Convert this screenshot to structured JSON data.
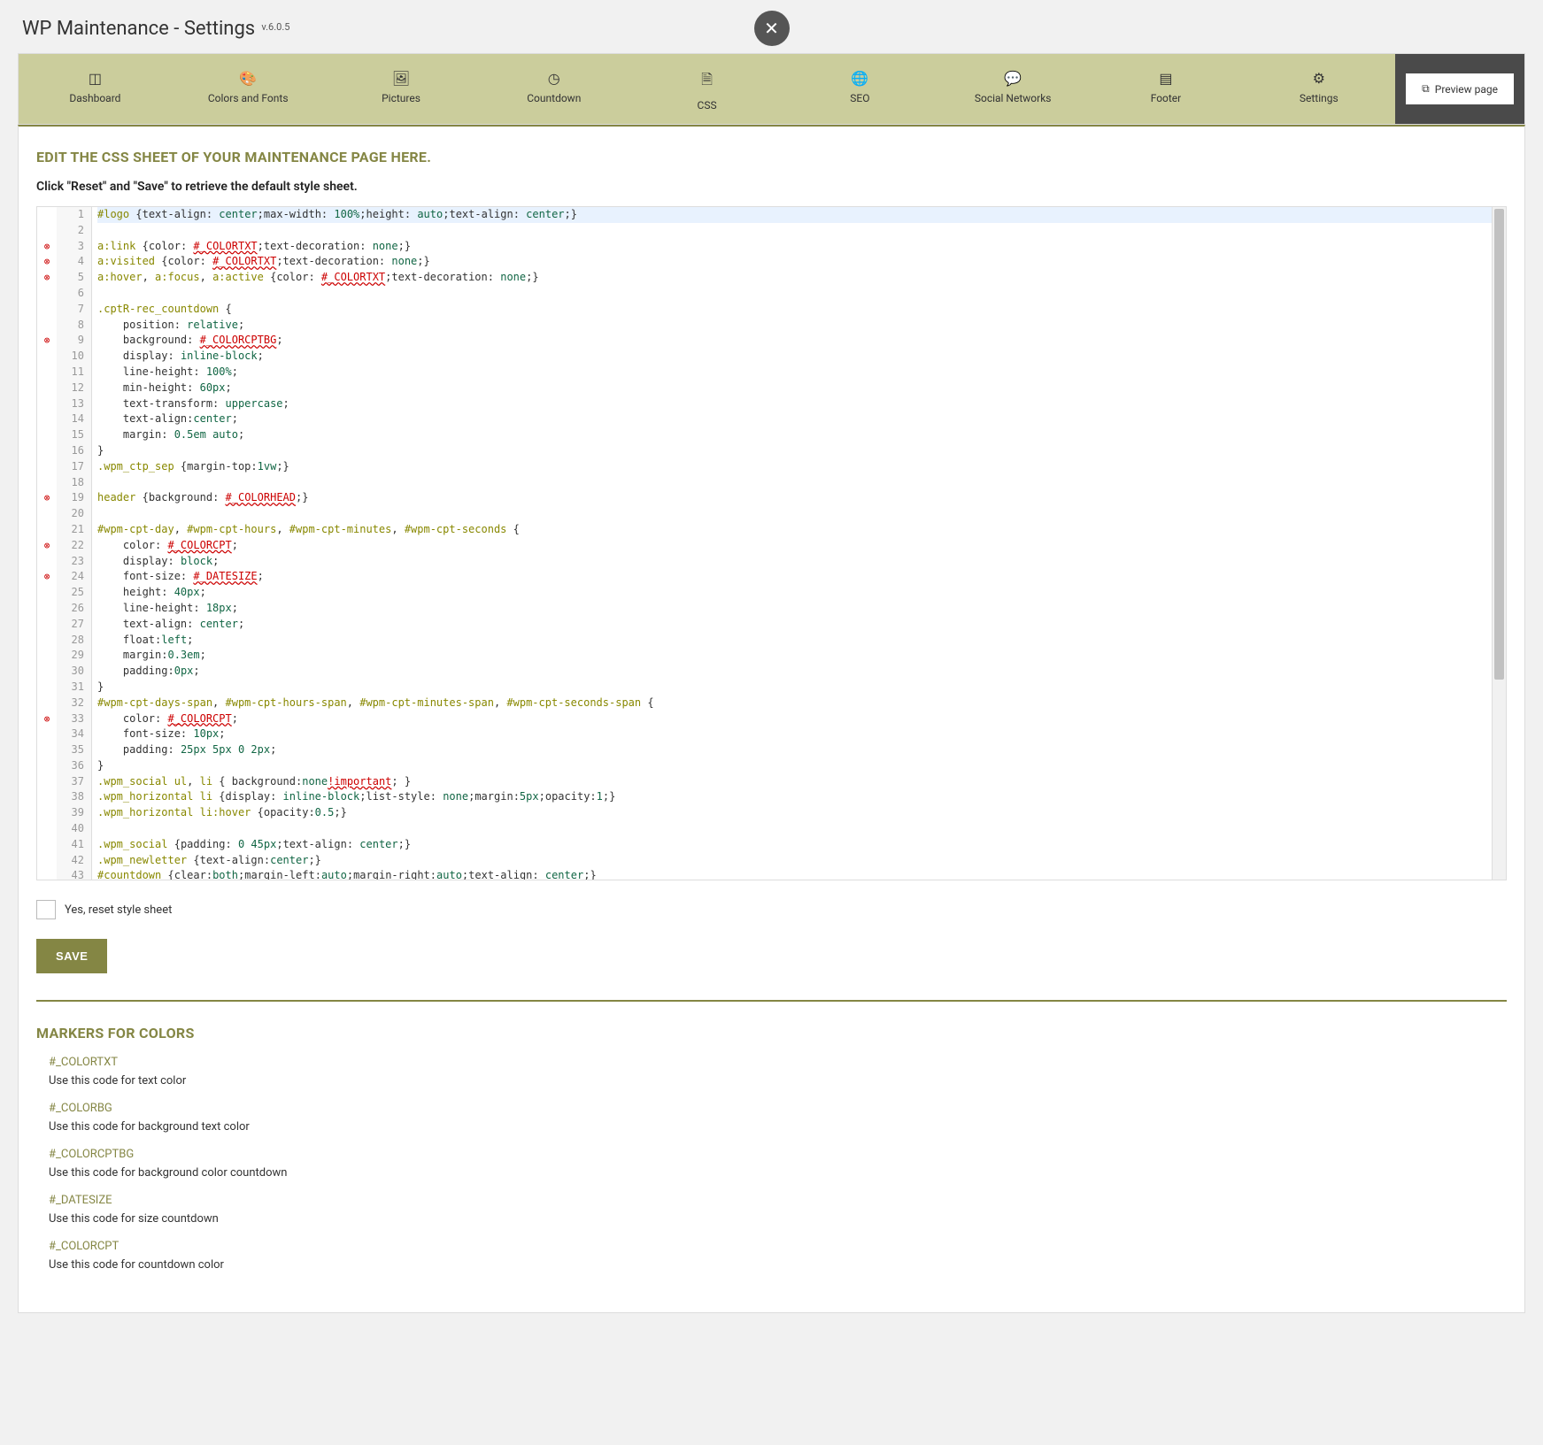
{
  "header": {
    "title": "WP Maintenance - Settings",
    "version": "v.6.0.5"
  },
  "tabs": [
    {
      "icon": "◫",
      "label": "Dashboard"
    },
    {
      "icon": "🎨",
      "label": "Colors and Fonts"
    },
    {
      "icon": "🖼",
      "label": "Pictures"
    },
    {
      "icon": "◷",
      "label": "Countdown"
    },
    {
      "icon": "🗎",
      "label": "CSS"
    },
    {
      "icon": "🌐",
      "label": "SEO"
    },
    {
      "icon": "💬",
      "label": "Social Networks"
    },
    {
      "icon": "▤",
      "label": "Footer"
    },
    {
      "icon": "⚙",
      "label": "Settings"
    }
  ],
  "preview_label": "Preview page",
  "section": {
    "heading": "EDIT THE CSS SHEET OF YOUR MAINTENANCE PAGE HERE.",
    "sub": "Click \"Reset\" and \"Save\" to retrieve the default style sheet."
  },
  "editor": {
    "error_lines": [
      3,
      4,
      5,
      9,
      19,
      22,
      24,
      33
    ],
    "lines": [
      {
        "n": 1,
        "hl": true,
        "segs": [
          [
            "sel",
            "#logo "
          ],
          [
            "brace",
            "{"
          ],
          [
            "prop",
            "text-align"
          ],
          [
            "brace",
            ": "
          ],
          [
            "valk",
            "center"
          ],
          [
            "brace",
            ";"
          ],
          [
            "prop",
            "max-width"
          ],
          [
            "brace",
            ": "
          ],
          [
            "num",
            "100%"
          ],
          [
            "brace",
            ";"
          ],
          [
            "prop",
            "height"
          ],
          [
            "brace",
            ": "
          ],
          [
            "valk",
            "auto"
          ],
          [
            "brace",
            ";"
          ],
          [
            "prop",
            "text-align"
          ],
          [
            "brace",
            ": "
          ],
          [
            "valk",
            "center"
          ],
          [
            "brace",
            ";}"
          ]
        ]
      },
      {
        "n": 2,
        "segs": []
      },
      {
        "n": 3,
        "segs": [
          [
            "sel",
            "a:link "
          ],
          [
            "brace",
            "{"
          ],
          [
            "prop",
            "color"
          ],
          [
            "brace",
            ": "
          ],
          [
            "err-tok",
            "#_COLORTXT"
          ],
          [
            "brace",
            ";"
          ],
          [
            "prop",
            "text-decoration"
          ],
          [
            "brace",
            ": "
          ],
          [
            "valk",
            "none"
          ],
          [
            "brace",
            ";}"
          ]
        ]
      },
      {
        "n": 4,
        "segs": [
          [
            "sel",
            "a:visited "
          ],
          [
            "brace",
            "{"
          ],
          [
            "prop",
            "color"
          ],
          [
            "brace",
            ": "
          ],
          [
            "err-tok",
            "#_COLORTXT"
          ],
          [
            "brace",
            ";"
          ],
          [
            "prop",
            "text-decoration"
          ],
          [
            "brace",
            ": "
          ],
          [
            "valk",
            "none"
          ],
          [
            "brace",
            ";}"
          ]
        ]
      },
      {
        "n": 5,
        "segs": [
          [
            "sel",
            "a:hover"
          ],
          [
            "brace",
            ", "
          ],
          [
            "sel",
            "a:focus"
          ],
          [
            "brace",
            ", "
          ],
          [
            "sel",
            "a:active "
          ],
          [
            "brace",
            "{"
          ],
          [
            "prop",
            "color"
          ],
          [
            "brace",
            ": "
          ],
          [
            "err-tok",
            "#_COLORTXT"
          ],
          [
            "brace",
            ";"
          ],
          [
            "prop",
            "text-decoration"
          ],
          [
            "brace",
            ": "
          ],
          [
            "valk",
            "none"
          ],
          [
            "brace",
            ";}"
          ]
        ]
      },
      {
        "n": 6,
        "segs": []
      },
      {
        "n": 7,
        "segs": [
          [
            "sel",
            ".cptR-rec_countdown "
          ],
          [
            "brace",
            "{"
          ]
        ]
      },
      {
        "n": 8,
        "segs": [
          [
            "prop",
            "    position"
          ],
          [
            "brace",
            ": "
          ],
          [
            "valk",
            "relative"
          ],
          [
            "brace",
            ";"
          ]
        ]
      },
      {
        "n": 9,
        "segs": [
          [
            "prop",
            "    background"
          ],
          [
            "brace",
            ": "
          ],
          [
            "err-tok",
            "#_COLORCPTBG"
          ],
          [
            "brace",
            ";"
          ]
        ]
      },
      {
        "n": 10,
        "segs": [
          [
            "prop",
            "    display"
          ],
          [
            "brace",
            ": "
          ],
          [
            "valk",
            "inline-block"
          ],
          [
            "brace",
            ";"
          ]
        ]
      },
      {
        "n": 11,
        "segs": [
          [
            "prop",
            "    line-height"
          ],
          [
            "brace",
            ": "
          ],
          [
            "num",
            "100%"
          ],
          [
            "brace",
            ";"
          ]
        ]
      },
      {
        "n": 12,
        "segs": [
          [
            "prop",
            "    min-height"
          ],
          [
            "brace",
            ": "
          ],
          [
            "num",
            "60px"
          ],
          [
            "brace",
            ";"
          ]
        ]
      },
      {
        "n": 13,
        "segs": [
          [
            "prop",
            "    text-transform"
          ],
          [
            "brace",
            ": "
          ],
          [
            "valk",
            "uppercase"
          ],
          [
            "brace",
            ";"
          ]
        ]
      },
      {
        "n": 14,
        "segs": [
          [
            "prop",
            "    text-align"
          ],
          [
            "brace",
            ":"
          ],
          [
            "valk",
            "center"
          ],
          [
            "brace",
            ";"
          ]
        ]
      },
      {
        "n": 15,
        "segs": [
          [
            "prop",
            "    margin"
          ],
          [
            "brace",
            ": "
          ],
          [
            "num",
            "0.5em "
          ],
          [
            "valk",
            "auto"
          ],
          [
            "brace",
            ";"
          ]
        ]
      },
      {
        "n": 16,
        "segs": [
          [
            "brace",
            "}"
          ]
        ]
      },
      {
        "n": 17,
        "segs": [
          [
            "sel",
            ".wpm_ctp_sep "
          ],
          [
            "brace",
            "{"
          ],
          [
            "prop",
            "margin-top"
          ],
          [
            "brace",
            ":"
          ],
          [
            "num",
            "1vw"
          ],
          [
            "brace",
            ";}"
          ]
        ]
      },
      {
        "n": 18,
        "segs": []
      },
      {
        "n": 19,
        "segs": [
          [
            "sel",
            "header "
          ],
          [
            "brace",
            "{"
          ],
          [
            "prop",
            "background"
          ],
          [
            "brace",
            ": "
          ],
          [
            "err-tok",
            "#_COLORHEAD"
          ],
          [
            "brace",
            ";}"
          ]
        ]
      },
      {
        "n": 20,
        "segs": []
      },
      {
        "n": 21,
        "segs": [
          [
            "sel",
            "#wpm-cpt-day"
          ],
          [
            "brace",
            ", "
          ],
          [
            "sel",
            "#wpm-cpt-hours"
          ],
          [
            "brace",
            ", "
          ],
          [
            "sel",
            "#wpm-cpt-minutes"
          ],
          [
            "brace",
            ", "
          ],
          [
            "sel",
            "#wpm-cpt-seconds "
          ],
          [
            "brace",
            "{"
          ]
        ]
      },
      {
        "n": 22,
        "segs": [
          [
            "prop",
            "    color"
          ],
          [
            "brace",
            ": "
          ],
          [
            "err-tok",
            "#_COLORCPT"
          ],
          [
            "brace",
            ";"
          ]
        ]
      },
      {
        "n": 23,
        "segs": [
          [
            "prop",
            "    display"
          ],
          [
            "brace",
            ": "
          ],
          [
            "valk",
            "block"
          ],
          [
            "brace",
            ";"
          ]
        ]
      },
      {
        "n": 24,
        "segs": [
          [
            "prop",
            "    font-size"
          ],
          [
            "brace",
            ": "
          ],
          [
            "err-tok",
            "#_DATESIZE"
          ],
          [
            "brace",
            ";"
          ]
        ]
      },
      {
        "n": 25,
        "segs": [
          [
            "prop",
            "    height"
          ],
          [
            "brace",
            ": "
          ],
          [
            "num",
            "40px"
          ],
          [
            "brace",
            ";"
          ]
        ]
      },
      {
        "n": 26,
        "segs": [
          [
            "prop",
            "    line-height"
          ],
          [
            "brace",
            ": "
          ],
          [
            "num",
            "18px"
          ],
          [
            "brace",
            ";"
          ]
        ]
      },
      {
        "n": 27,
        "segs": [
          [
            "prop",
            "    text-align"
          ],
          [
            "brace",
            ": "
          ],
          [
            "valk",
            "center"
          ],
          [
            "brace",
            ";"
          ]
        ]
      },
      {
        "n": 28,
        "segs": [
          [
            "prop",
            "    float"
          ],
          [
            "brace",
            ":"
          ],
          [
            "valk",
            "left"
          ],
          [
            "brace",
            ";"
          ]
        ]
      },
      {
        "n": 29,
        "segs": [
          [
            "prop",
            "    margin"
          ],
          [
            "brace",
            ":"
          ],
          [
            "num",
            "0.3em"
          ],
          [
            "brace",
            ";"
          ]
        ]
      },
      {
        "n": 30,
        "segs": [
          [
            "prop",
            "    padding"
          ],
          [
            "brace",
            ":"
          ],
          [
            "num",
            "0px"
          ],
          [
            "brace",
            ";"
          ]
        ]
      },
      {
        "n": 31,
        "segs": [
          [
            "brace",
            "}"
          ]
        ]
      },
      {
        "n": 32,
        "segs": [
          [
            "sel",
            "#wpm-cpt-days-span"
          ],
          [
            "brace",
            ", "
          ],
          [
            "sel",
            "#wpm-cpt-hours-span"
          ],
          [
            "brace",
            ", "
          ],
          [
            "sel",
            "#wpm-cpt-minutes-span"
          ],
          [
            "brace",
            ", "
          ],
          [
            "sel",
            "#wpm-cpt-seconds-span "
          ],
          [
            "brace",
            "{"
          ]
        ]
      },
      {
        "n": 33,
        "segs": [
          [
            "prop",
            "    color"
          ],
          [
            "brace",
            ": "
          ],
          [
            "err-tok",
            "#_COLORCPT"
          ],
          [
            "brace",
            ";"
          ]
        ]
      },
      {
        "n": 34,
        "segs": [
          [
            "prop",
            "    font-size"
          ],
          [
            "brace",
            ": "
          ],
          [
            "num",
            "10px"
          ],
          [
            "brace",
            ";"
          ]
        ]
      },
      {
        "n": 35,
        "segs": [
          [
            "prop",
            "    padding"
          ],
          [
            "brace",
            ": "
          ],
          [
            "num",
            "25px 5px 0 2px"
          ],
          [
            "brace",
            ";"
          ]
        ]
      },
      {
        "n": 36,
        "segs": [
          [
            "brace",
            "}"
          ]
        ]
      },
      {
        "n": 37,
        "segs": [
          [
            "sel",
            ".wpm_social ul"
          ],
          [
            "brace",
            ", "
          ],
          [
            "sel",
            "li "
          ],
          [
            "brace",
            "{ "
          ],
          [
            "prop",
            "background"
          ],
          [
            "brace",
            ":"
          ],
          [
            "valk",
            "none"
          ],
          [
            "err-tok",
            "!important"
          ],
          [
            "brace",
            "; }"
          ]
        ]
      },
      {
        "n": 38,
        "segs": [
          [
            "sel",
            ".wpm_horizontal li "
          ],
          [
            "brace",
            "{"
          ],
          [
            "prop",
            "display"
          ],
          [
            "brace",
            ": "
          ],
          [
            "valk",
            "inline-block"
          ],
          [
            "brace",
            ";"
          ],
          [
            "prop",
            "list-style"
          ],
          [
            "brace",
            ": "
          ],
          [
            "valk",
            "none"
          ],
          [
            "brace",
            ";"
          ],
          [
            "prop",
            "margin"
          ],
          [
            "brace",
            ":"
          ],
          [
            "num",
            "5px"
          ],
          [
            "brace",
            ";"
          ],
          [
            "prop",
            "opacity"
          ],
          [
            "brace",
            ":"
          ],
          [
            "num",
            "1"
          ],
          [
            "brace",
            ";}"
          ]
        ]
      },
      {
        "n": 39,
        "segs": [
          [
            "sel",
            ".wpm_horizontal li:hover "
          ],
          [
            "brace",
            "{"
          ],
          [
            "prop",
            "opacity"
          ],
          [
            "brace",
            ":"
          ],
          [
            "num",
            "0.5"
          ],
          [
            "brace",
            ";}"
          ]
        ]
      },
      {
        "n": 40,
        "segs": []
      },
      {
        "n": 41,
        "segs": [
          [
            "sel",
            ".wpm_social "
          ],
          [
            "brace",
            "{"
          ],
          [
            "prop",
            "padding"
          ],
          [
            "brace",
            ": "
          ],
          [
            "num",
            "0 45px"
          ],
          [
            "brace",
            ";"
          ],
          [
            "prop",
            "text-align"
          ],
          [
            "brace",
            ": "
          ],
          [
            "valk",
            "center"
          ],
          [
            "brace",
            ";}"
          ]
        ]
      },
      {
        "n": 42,
        "segs": [
          [
            "sel",
            ".wpm_newletter "
          ],
          [
            "brace",
            "{"
          ],
          [
            "prop",
            "text-align"
          ],
          [
            "brace",
            ":"
          ],
          [
            "valk",
            "center"
          ],
          [
            "brace",
            ";}"
          ]
        ]
      },
      {
        "n": 43,
        "segs": [
          [
            "sel",
            "#countdown "
          ],
          [
            "brace",
            "{"
          ],
          [
            "prop",
            "clear"
          ],
          [
            "brace",
            ":"
          ],
          [
            "valk",
            "both"
          ],
          [
            "brace",
            ";"
          ],
          [
            "prop",
            "margin-left"
          ],
          [
            "brace",
            ":"
          ],
          [
            "valk",
            "auto"
          ],
          [
            "brace",
            ";"
          ],
          [
            "prop",
            "margin-right"
          ],
          [
            "brace",
            ":"
          ],
          [
            "valk",
            "auto"
          ],
          [
            "brace",
            ";"
          ],
          [
            "prop",
            "text-align"
          ],
          [
            "brace",
            ": "
          ],
          [
            "valk",
            "center"
          ],
          [
            "brace",
            ";}"
          ]
        ]
      }
    ]
  },
  "reset_checkbox": "Yes, reset style sheet",
  "save_button": "SAVE",
  "markers": {
    "heading": "MARKERS FOR COLORS",
    "items": [
      {
        "name": "#_COLORTXT",
        "desc": "Use this code for text color"
      },
      {
        "name": "#_COLORBG",
        "desc": "Use this code for background text color"
      },
      {
        "name": "#_COLORCPTBG",
        "desc": "Use this code for background color countdown"
      },
      {
        "name": "#_DATESIZE",
        "desc": "Use this code for size countdown"
      },
      {
        "name": "#_COLORCPT",
        "desc": "Use this code for countdown color"
      }
    ]
  }
}
